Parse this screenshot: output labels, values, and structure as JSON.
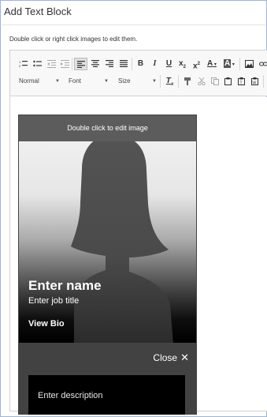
{
  "dialog": {
    "title": "Add Text Block",
    "hint": "Double click or right click images to edit them."
  },
  "toolbar": {
    "row1": [
      {
        "icon": "numbered-list-icon",
        "glyph": "≔"
      },
      {
        "icon": "bulleted-list-icon",
        "glyph": "☰"
      },
      {
        "icon": "decrease-indent-icon",
        "glyph": "⇤"
      },
      {
        "icon": "increase-indent-icon",
        "glyph": "⇥"
      },
      {
        "icon": "align-left-icon",
        "glyph": "≡"
      },
      {
        "icon": "align-center-icon",
        "glyph": "≡"
      },
      {
        "icon": "align-right-icon",
        "glyph": "≡"
      },
      {
        "icon": "justify-icon",
        "glyph": "≡"
      }
    ],
    "bold": "B",
    "italic": "I",
    "underline": "U",
    "subscript": "x",
    "superscript": "x",
    "text_color": "A",
    "bg_color": "A",
    "format": "Normal",
    "font": "Font",
    "size": "Size",
    "clear_format": "T"
  },
  "card": {
    "edit_hint": "Double click to edit image",
    "name": "Enter name",
    "job_title": "Enter job title",
    "view_bio": "View Bio",
    "close_label": "Close",
    "close_glyph": "✕",
    "description": "Enter description"
  },
  "colors": {
    "border": "#9bb6d4",
    "toolbar_bg": "#f8f8f8",
    "card_top": "#5c5c5c",
    "panel": "#424242"
  }
}
